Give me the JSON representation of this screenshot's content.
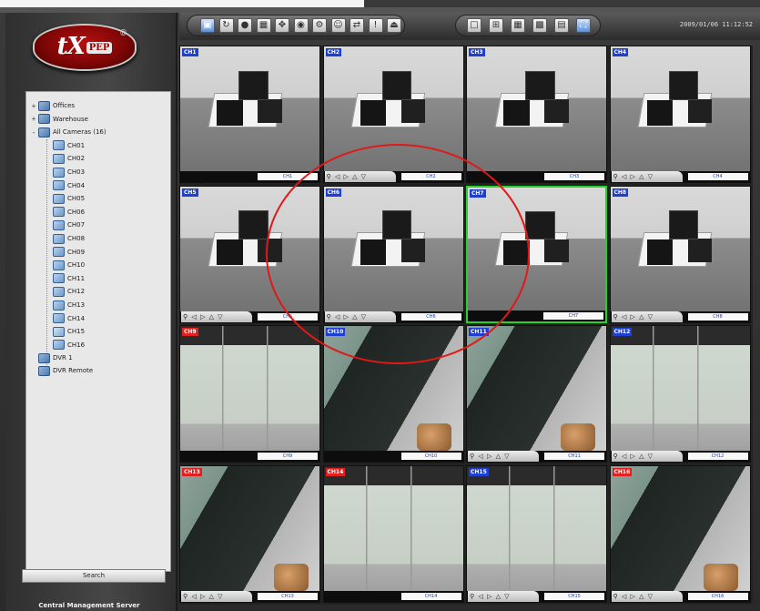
{
  "app": {
    "logo_text": "tX",
    "logo_badge": "PEP",
    "logo_mark": "®",
    "footer_label": "Central Management Server",
    "datetime": "2009/01/06 11:12:52"
  },
  "sidebar": {
    "button_label": "Search",
    "tree": [
      {
        "label": "Offices",
        "level": 0,
        "type": "group",
        "expander": "+"
      },
      {
        "label": "Warehouse",
        "level": 0,
        "type": "group",
        "expander": "+"
      },
      {
        "label": "All Cameras (16)",
        "level": 0,
        "type": "group",
        "expander": "-"
      },
      {
        "label": "CH01",
        "level": 1,
        "type": "cam"
      },
      {
        "label": "CH02",
        "level": 1,
        "type": "cam"
      },
      {
        "label": "CH03",
        "level": 1,
        "type": "cam"
      },
      {
        "label": "CH04",
        "level": 1,
        "type": "cam"
      },
      {
        "label": "CH05",
        "level": 1,
        "type": "cam"
      },
      {
        "label": "CH06",
        "level": 1,
        "type": "cam"
      },
      {
        "label": "CH07",
        "level": 1,
        "type": "cam"
      },
      {
        "label": "CH08",
        "level": 1,
        "type": "cam"
      },
      {
        "label": "CH09",
        "level": 1,
        "type": "cam"
      },
      {
        "label": "CH10",
        "level": 1,
        "type": "cam"
      },
      {
        "label": "CH11",
        "level": 1,
        "type": "cam"
      },
      {
        "label": "CH12",
        "level": 1,
        "type": "cam"
      },
      {
        "label": "CH13",
        "level": 1,
        "type": "cam"
      },
      {
        "label": "CH14",
        "level": 1,
        "type": "cam"
      },
      {
        "label": "CH15",
        "level": 1,
        "type": "cam",
        "selected": true
      },
      {
        "label": "CH16",
        "level": 1,
        "type": "cam"
      },
      {
        "label": "DVR 1",
        "level": 0,
        "type": "group",
        "expander": ""
      },
      {
        "label": "DVR Remote",
        "level": 0,
        "type": "group",
        "expander": ""
      }
    ]
  },
  "toolbar": {
    "tools": [
      "camera-view",
      "playback",
      "record",
      "layout",
      "ptz",
      "snapshot",
      "config",
      "user",
      "network",
      "alarm",
      "exit"
    ],
    "layouts": [
      "1x1",
      "2x2",
      "3x3",
      "4x4",
      "custom",
      "full"
    ]
  },
  "grid": {
    "rows": 4,
    "cols": 4,
    "selected_index": 6,
    "tiles": [
      {
        "label": "CH1",
        "scene": "office",
        "name": "CH1",
        "label_color": "blue",
        "ptz": false
      },
      {
        "label": "CH2",
        "scene": "office",
        "name": "CH2",
        "label_color": "blue",
        "ptz": true
      },
      {
        "label": "CH3",
        "scene": "office",
        "name": "CH3",
        "label_color": "blue",
        "ptz": false
      },
      {
        "label": "CH4",
        "scene": "office",
        "name": "CH4",
        "label_color": "blue",
        "ptz": true
      },
      {
        "label": "CH5",
        "scene": "office",
        "name": "CH5",
        "label_color": "blue",
        "ptz": true
      },
      {
        "label": "CH6",
        "scene": "office",
        "name": "CH6",
        "label_color": "blue",
        "ptz": true
      },
      {
        "label": "CH7",
        "scene": "office",
        "name": "CH7",
        "label_color": "blue",
        "ptz": false
      },
      {
        "label": "CH8",
        "scene": "office",
        "name": "CH8",
        "label_color": "blue",
        "ptz": true
      },
      {
        "label": "CH9",
        "scene": "lockers",
        "name": "CH9",
        "label_color": "red",
        "ptz": false
      },
      {
        "label": "CH10",
        "scene": "board",
        "name": "CH10",
        "label_color": "blue",
        "ptz": false
      },
      {
        "label": "CH11",
        "scene": "board",
        "name": "CH11",
        "label_color": "blue",
        "ptz": true
      },
      {
        "label": "CH12",
        "scene": "lockers",
        "name": "CH12",
        "label_color": "blue",
        "ptz": true
      },
      {
        "label": "CH13",
        "scene": "board",
        "name": "CH13",
        "label_color": "red",
        "ptz": true
      },
      {
        "label": "CH14",
        "scene": "lockers",
        "name": "CH14",
        "label_color": "red",
        "ptz": false
      },
      {
        "label": "CH15",
        "scene": "lockers",
        "name": "CH15",
        "label_color": "blue",
        "ptz": true
      },
      {
        "label": "CH16",
        "scene": "board",
        "name": "CH16",
        "label_color": "red",
        "ptz": true
      }
    ]
  },
  "colors": {
    "selected_border": "#2ad12a",
    "annotation": "#e01818",
    "label_blue": "#1e3fd0",
    "label_red": "#e12020"
  }
}
